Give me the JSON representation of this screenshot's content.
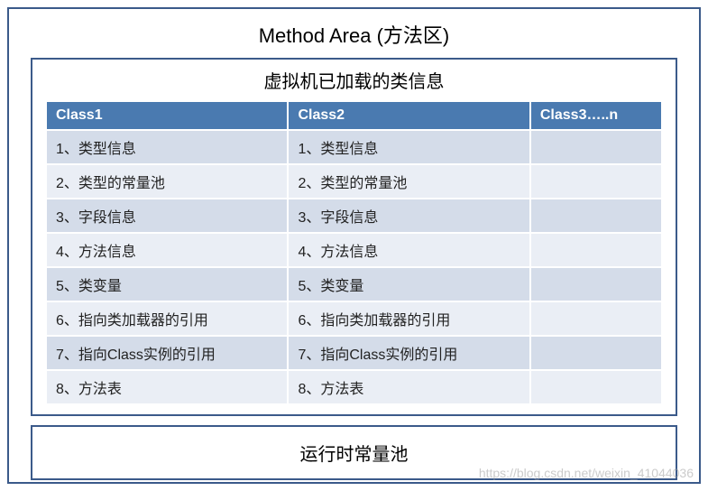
{
  "title": "Method Area (方法区)",
  "subtitle": "虚拟机已加载的类信息",
  "columns": [
    "Class1",
    "Class2",
    "Class3…..n"
  ],
  "rows": [
    [
      "1、类型信息",
      "1、类型信息",
      ""
    ],
    [
      "2、类型的常量池",
      "2、类型的常量池",
      ""
    ],
    [
      "3、字段信息",
      "3、字段信息",
      ""
    ],
    [
      "4、方法信息",
      "4、方法信息",
      ""
    ],
    [
      "5、类变量",
      "5、类变量",
      ""
    ],
    [
      "6、指向类加载器的引用",
      "6、指向类加载器的引用",
      ""
    ],
    [
      "7、指向Class实例的引用",
      "7、指向Class实例的引用",
      ""
    ],
    [
      "8、方法表",
      "8、方法表",
      ""
    ]
  ],
  "runtime_pool": "运行时常量池",
  "watermark": "https://blog.csdn.net/weixin_41044036"
}
